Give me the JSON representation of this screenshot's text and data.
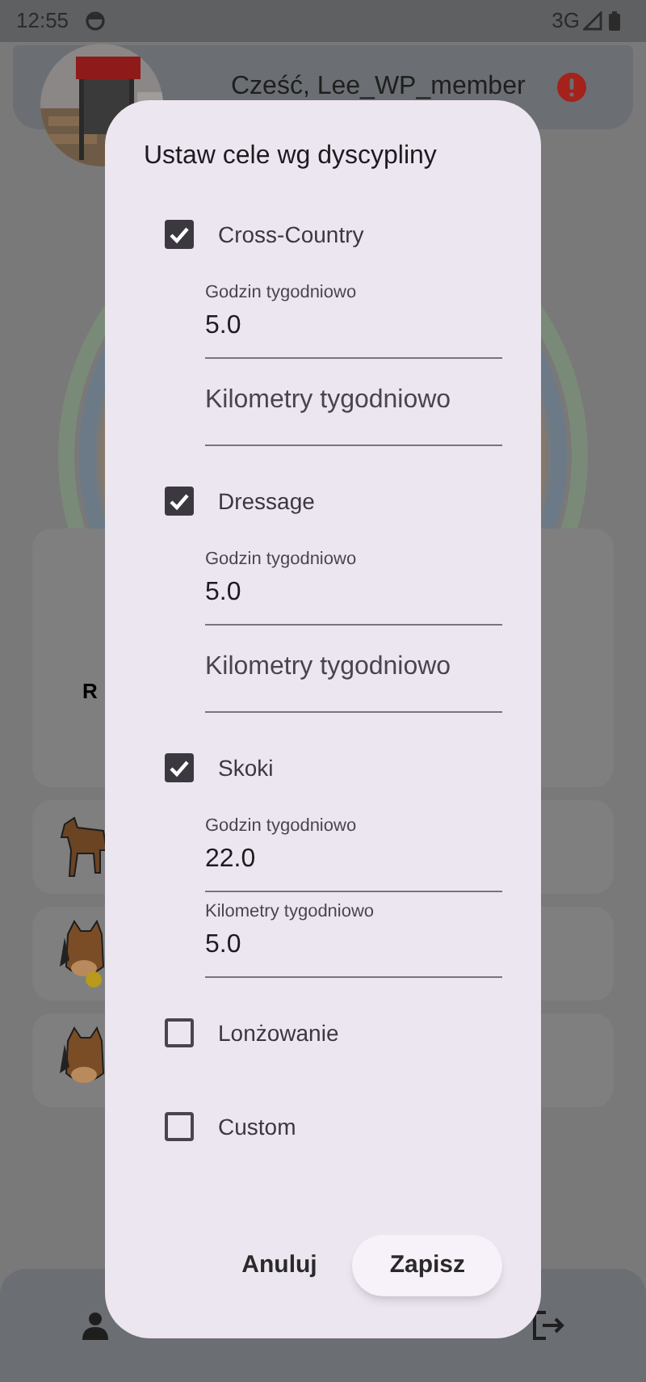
{
  "status_bar": {
    "time": "12:55",
    "network": "3G"
  },
  "header": {
    "greeting": "Cześć, Lee_WP_member"
  },
  "background": {
    "card_text": "R"
  },
  "dialog": {
    "title": "Ustaw cele wg dyscypliny",
    "disciplines": [
      {
        "name": "Cross-Country",
        "checked": true,
        "fields": [
          {
            "label": "Godzin tygodniowo",
            "value": "5.0"
          },
          {
            "label": "Kilometry tygodniowo"
          }
        ]
      },
      {
        "name": "Dressage",
        "checked": true,
        "fields": [
          {
            "label": "Godzin tygodniowo",
            "value": "5.0"
          },
          {
            "label": "Kilometry tygodniowo"
          }
        ]
      },
      {
        "name": "Skoki",
        "checked": true,
        "fields": [
          {
            "label": "Godzin tygodniowo",
            "value": "22.0"
          },
          {
            "label": "Kilometry tygodniowo",
            "value": "5.0"
          }
        ]
      },
      {
        "name": "Lonżowanie",
        "checked": false
      },
      {
        "name": "Custom",
        "checked": false
      }
    ],
    "buttons": [
      {
        "label": "Anuluj",
        "kind": "text"
      },
      {
        "label": "Zapisz",
        "kind": "filled"
      }
    ]
  }
}
